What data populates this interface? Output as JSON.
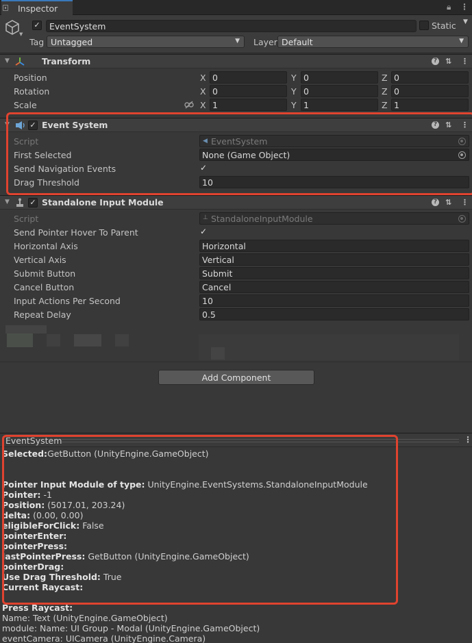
{
  "tab": {
    "title": "Inspector"
  },
  "object": {
    "name": "EventSystem",
    "static_label": "Static",
    "tag_label": "Tag",
    "tag_value": "Untagged",
    "layer_label": "Layer",
    "layer_value": "Default"
  },
  "transform": {
    "title": "Transform",
    "position_label": "Position",
    "rotation_label": "Rotation",
    "scale_label": "Scale",
    "x_label": "X",
    "y_label": "Y",
    "z_label": "Z",
    "position": [
      "0",
      "0",
      "0"
    ],
    "rotation": [
      "0",
      "0",
      "0"
    ],
    "scale": [
      "1",
      "1",
      "1"
    ]
  },
  "event_system": {
    "title": "Event System",
    "script_label": "Script",
    "script_value": "EventSystem",
    "first_selected_label": "First Selected",
    "first_selected_value": "None (Game Object)",
    "send_nav_label": "Send Navigation Events",
    "send_nav_checked": true,
    "drag_threshold_label": "Drag Threshold",
    "drag_threshold_value": "10"
  },
  "input_module": {
    "title": "Standalone Input Module",
    "script_label": "Script",
    "script_value": "StandaloneInputModule",
    "hover_label": "Send Pointer Hover To Parent",
    "hover_checked": true,
    "horizontal_label": "Horizontal Axis",
    "horizontal_value": "Horizontal",
    "vertical_label": "Vertical Axis",
    "vertical_value": "Vertical",
    "submit_label": "Submit Button",
    "submit_value": "Submit",
    "cancel_label": "Cancel Button",
    "cancel_value": "Cancel",
    "aps_label": "Input Actions Per Second",
    "aps_value": "10",
    "repeat_label": "Repeat Delay",
    "repeat_value": "0.5"
  },
  "add_component": "Add Component",
  "preview": {
    "title": "EventSystem",
    "lines": [
      {
        "key": "Selected:",
        "val": "GetButton (UnityEngine.GameObject)"
      },
      {
        "key": "Pointer Input Module of type:",
        "val": " UnityEngine.EventSystems.StandaloneInputModule"
      },
      {
        "key": "Pointer:",
        "val": " -1"
      },
      {
        "key": "Position:",
        "val": " (5017.01, 203.24)"
      },
      {
        "key": "delta:",
        "val": " (0.00, 0.00)"
      },
      {
        "key": "eligibleForClick:",
        "val": " False"
      },
      {
        "key": "pointerEnter:",
        "val": ""
      },
      {
        "key": "pointerPress:",
        "val": ""
      },
      {
        "key": "lastPointerPress:",
        "val": " GetButton (UnityEngine.GameObject)"
      },
      {
        "key": "pointerDrag:",
        "val": ""
      },
      {
        "key": "Use Drag Threshold:",
        "val": " True"
      },
      {
        "key": "Current Raycast:",
        "val": ""
      },
      {
        "key": "Press Raycast:",
        "val": ""
      },
      {
        "key": "",
        "val": "Name: Text (UnityEngine.GameObject)"
      },
      {
        "key": "",
        "val": "module: Name: UI Group - Modal (UnityEngine.GameObject)"
      },
      {
        "key": "",
        "val": "eventCamera: UICamera (UnityEngine.Camera)"
      }
    ]
  },
  "colors": {
    "highlight_box": "#e0432f",
    "tab_accent": "#3a79bb"
  }
}
